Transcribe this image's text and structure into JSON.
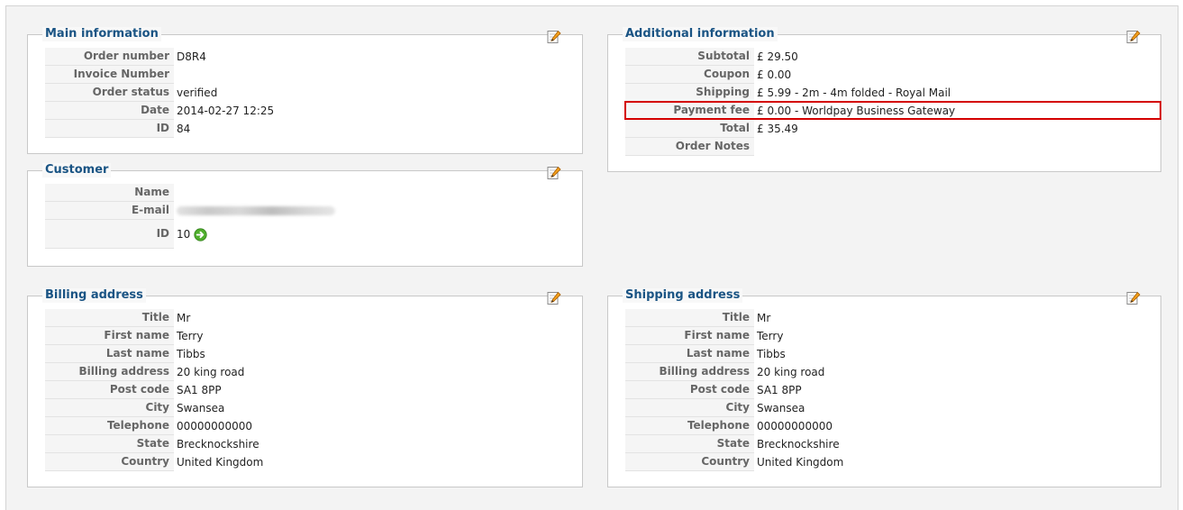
{
  "main_information": {
    "title": "Main information",
    "rows": [
      {
        "label": "Order number",
        "value": "D8R4"
      },
      {
        "label": "Invoice Number",
        "value": ""
      },
      {
        "label": "Order status",
        "value": "verified"
      },
      {
        "label": "Date",
        "value": "2014-02-27 12:25"
      },
      {
        "label": "ID",
        "value": "84"
      }
    ]
  },
  "customer": {
    "title": "Customer",
    "name_label": "Name",
    "name_value": "",
    "email_label": "E-mail",
    "id_label": "ID",
    "id_value": "10"
  },
  "additional_information": {
    "title": "Additional information",
    "rows": [
      {
        "label": "Subtotal",
        "value": "£ 29.50"
      },
      {
        "label": "Coupon",
        "value": "£ 0.00"
      },
      {
        "label": "Shipping",
        "value": "£ 5.99 - 2m - 4m folded - Royal Mail"
      },
      {
        "label": "Payment fee",
        "value": "£ 0.00 - Worldpay Business Gateway"
      },
      {
        "label": "Total",
        "value": "£ 35.49"
      },
      {
        "label": "Order Notes",
        "value": ""
      }
    ],
    "highlight_color": "#d40000"
  },
  "billing_address": {
    "title": "Billing address",
    "rows": [
      {
        "label": "Title",
        "value": "Mr"
      },
      {
        "label": "First name",
        "value": "Terry"
      },
      {
        "label": "Last name",
        "value": "Tibbs"
      },
      {
        "label": "Billing address",
        "value": "20 king road"
      },
      {
        "label": "Post code",
        "value": "SA1 8PP"
      },
      {
        "label": "City",
        "value": "Swansea"
      },
      {
        "label": "Telephone",
        "value": "00000000000"
      },
      {
        "label": "State",
        "value": "Brecknockshire"
      },
      {
        "label": "Country",
        "value": "United Kingdom"
      }
    ]
  },
  "shipping_address": {
    "title": "Shipping address",
    "rows": [
      {
        "label": "Title",
        "value": "Mr"
      },
      {
        "label": "First name",
        "value": "Terry"
      },
      {
        "label": "Last name",
        "value": "Tibbs"
      },
      {
        "label": "Billing address",
        "value": "20 king road"
      },
      {
        "label": "Post code",
        "value": "SA1 8PP"
      },
      {
        "label": "City",
        "value": "Swansea"
      },
      {
        "label": "Telephone",
        "value": "00000000000"
      },
      {
        "label": "State",
        "value": "Brecknockshire"
      },
      {
        "label": "Country",
        "value": "United Kingdom"
      }
    ]
  },
  "icons": {
    "edit": "edit-pencil-icon",
    "go": "go-arrow-icon"
  },
  "colors": {
    "legend_text": "#1a5484",
    "label_bg": "#f5f5f5",
    "label_text": "#666666",
    "panel_bg": "#f3f3f3"
  }
}
